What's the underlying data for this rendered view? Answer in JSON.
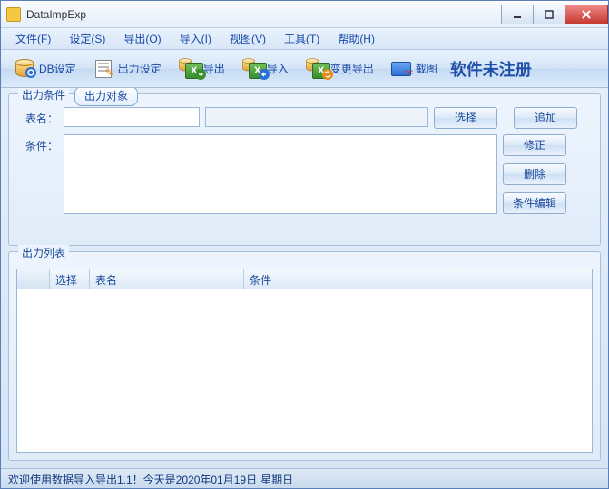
{
  "window": {
    "title": "DataImpExp"
  },
  "menu": {
    "file": "文件(F)",
    "settings": "设定(S)",
    "export": "导出(O)",
    "import": "导入(I)",
    "view": "视图(V)",
    "tools": "工具(T)",
    "help": "帮助(H)"
  },
  "toolbar": {
    "db_settings": "DB设定",
    "output_settings": "出力设定",
    "export": "导出",
    "import": "导入",
    "change_export": "变更导出",
    "screenshot": "截图",
    "unregistered": "软件未注册"
  },
  "conditions": {
    "group_label": "出力条件",
    "tab_target": "出力对象",
    "table_label": "表名：",
    "table_value": "",
    "table_desc": "",
    "condition_label": "条件：",
    "condition_value": "",
    "btn_select": "选择",
    "btn_add": "追加",
    "btn_edit": "修正",
    "btn_delete": "删除",
    "btn_cond_edit": "条件编辑"
  },
  "list": {
    "group_label": "出力列表",
    "col_select": "选择",
    "col_table": "表名",
    "col_condition": "条件"
  },
  "status": {
    "text": "欢迎使用数据导入导出1.1！今天是2020年01月19日",
    "weekday": "星期日"
  }
}
